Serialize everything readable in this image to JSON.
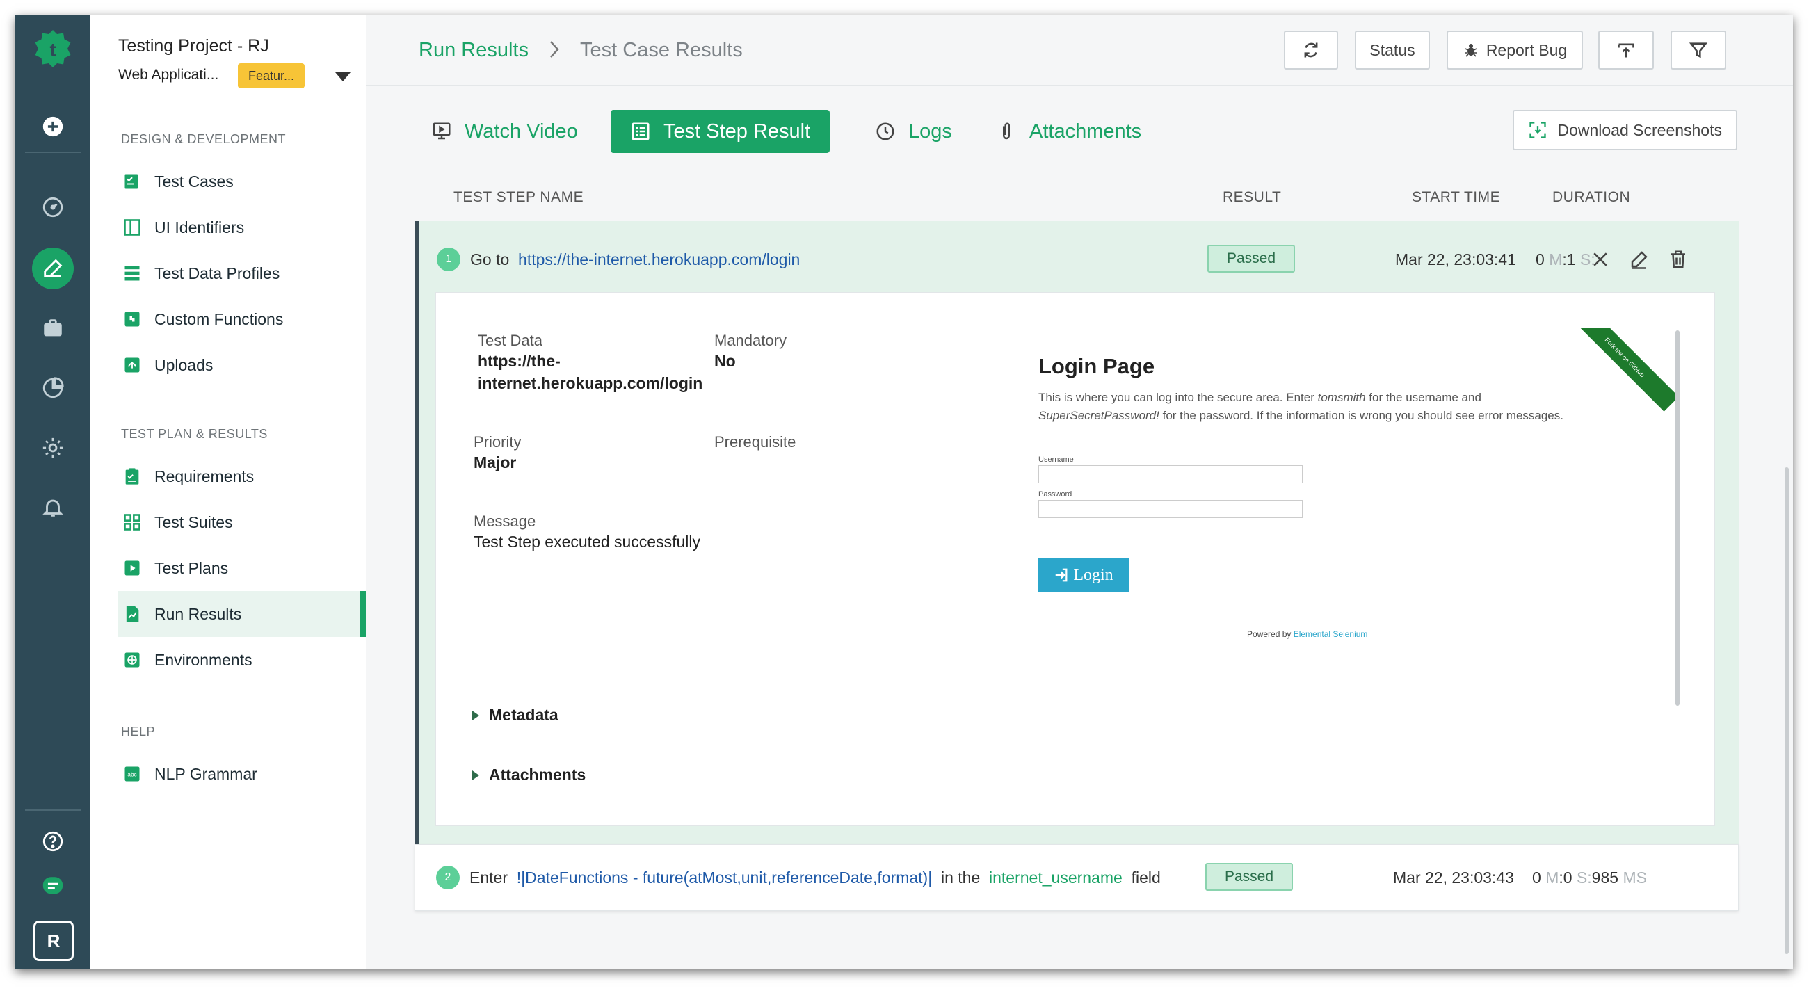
{
  "app": {
    "project_title": "Testing Project - RJ",
    "project_app": "Web Applicati...",
    "project_badge": "Featur...",
    "avatar_initial": "R"
  },
  "sidebar": {
    "sections": [
      {
        "title": "DESIGN & DEVELOPMENT",
        "items": [
          {
            "label": "Test Cases",
            "icon": "checklist-icon"
          },
          {
            "label": "UI Identifiers",
            "icon": "layout-icon"
          },
          {
            "label": "Test Data Profiles",
            "icon": "table-icon"
          },
          {
            "label": "Custom Functions",
            "icon": "puzzle-icon"
          },
          {
            "label": "Uploads",
            "icon": "upload-icon"
          }
        ]
      },
      {
        "title": "TEST PLAN & RESULTS",
        "items": [
          {
            "label": "Requirements",
            "icon": "clipboard-icon"
          },
          {
            "label": "Test Suites",
            "icon": "grid-icon"
          },
          {
            "label": "Test Plans",
            "icon": "play-icon"
          },
          {
            "label": "Run Results",
            "icon": "report-icon",
            "active": true
          },
          {
            "label": "Environments",
            "icon": "globe-icon"
          }
        ]
      },
      {
        "title": "HELP",
        "items": [
          {
            "label": "NLP Grammar",
            "icon": "abc-icon"
          }
        ]
      }
    ]
  },
  "header": {
    "breadcrumb_1": "Run Results",
    "breadcrumb_2": "Test Case Results",
    "status_label": "Status",
    "report_bug_label": "Report Bug"
  },
  "tabs": [
    {
      "label": "Watch Video",
      "icon": "monitor-icon"
    },
    {
      "label": "Test Step Result",
      "icon": "list-icon",
      "active": true
    },
    {
      "label": "Logs",
      "icon": "clock-icon"
    },
    {
      "label": "Attachments",
      "icon": "paperclip-icon"
    }
  ],
  "download_label": "Download Screenshots",
  "columns": {
    "name": "TEST STEP NAME",
    "result": "RESULT",
    "start": "START TIME",
    "duration": "DURATION"
  },
  "steps": [
    {
      "number": "1",
      "prefix": "Go to",
      "link": "https://the-internet.herokuapp.com/login",
      "result": "Passed",
      "start_time": "Mar 22, 23:03:41",
      "duration": {
        "m": "0",
        "m_unit": "M",
        "sep": ":",
        "s": "1",
        "s_unit": "S:"
      },
      "details": {
        "test_data_label": "Test Data",
        "test_data_value_1": "https://the-",
        "test_data_value_2": "internet.herokuapp.com/login",
        "mandatory_label": "Mandatory",
        "mandatory_value": "No",
        "priority_label": "Priority",
        "priority_value": "Major",
        "prerequisite_label": "Prerequisite",
        "message_label": "Message",
        "message_value": "Test Step executed successfully",
        "metadata_label": "Metadata",
        "attachments_label": "Attachments"
      },
      "screenshot": {
        "title": "Login Page",
        "desc_1": "This is where you can log into the secure area. Enter ",
        "desc_user": "tomsmith",
        "desc_2": " for the username and ",
        "desc_pass": "SuperSecretPassword!",
        "desc_3": " for the password. If the information is wrong you should see error messages.",
        "username_label": "Username",
        "password_label": "Password",
        "login_button": "Login",
        "powered_by": "Powered by ",
        "powered_link": "Elemental Selenium",
        "ribbon": "Fork me on GitHub"
      }
    },
    {
      "number": "2",
      "prefix": "Enter",
      "function": "!|DateFunctions - future(atMost,unit,referenceDate,format)|",
      "middle": "in the",
      "element": "internet_username",
      "suffix": "field",
      "result": "Passed",
      "start_time": "Mar 22, 23:03:43",
      "duration": {
        "m": "0",
        "m_unit": "M",
        "sep": ":",
        "s": "0",
        "s_unit": "S:",
        "ms": "985",
        "ms_unit": "MS"
      }
    }
  ],
  "colors": {
    "accent": "#1aa366",
    "rail": "#2e4a57",
    "passed_bg": "#cfeedd",
    "badge": "#f7c437"
  }
}
